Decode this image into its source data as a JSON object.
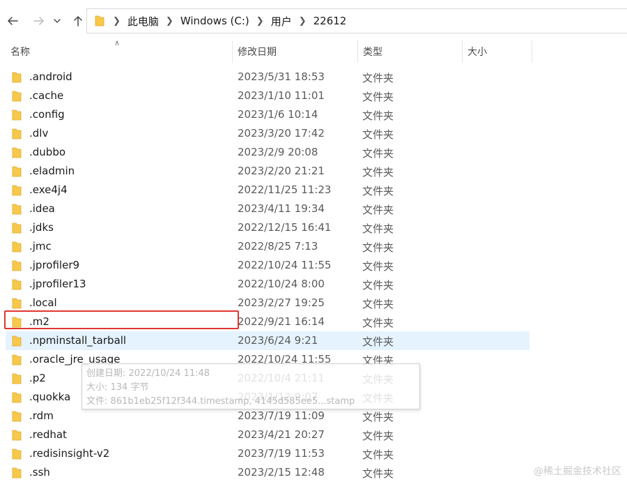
{
  "colors": {
    "accent": "#0078d4",
    "folder": "#f8c84a",
    "hover_row": "#e5f3ff",
    "highlight_box": "#e0362f"
  },
  "nav": {
    "back_icon": "arrow-left-icon",
    "forward_icon": "arrow-right-icon",
    "recent_icon": "chevron-down-icon",
    "up_icon": "arrow-up-icon"
  },
  "address": {
    "crumbs": [
      "此电脑",
      "Windows (C:)",
      "用户",
      "22612"
    ]
  },
  "columns": {
    "name": "名称",
    "modified": "修改日期",
    "type": "类型",
    "size": "大小"
  },
  "rows": [
    {
      "name": ".android",
      "modified": "2023/5/31 18:53",
      "type": "文件夹"
    },
    {
      "name": ".cache",
      "modified": "2023/1/10 11:01",
      "type": "文件夹"
    },
    {
      "name": ".config",
      "modified": "2023/1/6 10:14",
      "type": "文件夹"
    },
    {
      "name": ".dlv",
      "modified": "2023/3/20 17:42",
      "type": "文件夹"
    },
    {
      "name": ".dubbo",
      "modified": "2023/2/9 20:08",
      "type": "文件夹"
    },
    {
      "name": ".eladmin",
      "modified": "2023/2/20 21:21",
      "type": "文件夹"
    },
    {
      "name": ".exe4j4",
      "modified": "2022/11/25 11:23",
      "type": "文件夹"
    },
    {
      "name": ".idea",
      "modified": "2023/4/11 19:34",
      "type": "文件夹"
    },
    {
      "name": ".jdks",
      "modified": "2022/12/15 16:41",
      "type": "文件夹"
    },
    {
      "name": ".jmc",
      "modified": "2022/8/25 7:13",
      "type": "文件夹"
    },
    {
      "name": ".jprofiler9",
      "modified": "2022/10/24 11:55",
      "type": "文件夹"
    },
    {
      "name": ".jprofiler13",
      "modified": "2022/10/24 8:00",
      "type": "文件夹"
    },
    {
      "name": ".local",
      "modified": "2023/2/27 19:25",
      "type": "文件夹"
    },
    {
      "name": ".m2",
      "modified": "2022/9/21 16:14",
      "type": "文件夹"
    },
    {
      "name": ".npminstall_tarball",
      "modified": "2023/6/24 9:21",
      "type": "文件夹"
    },
    {
      "name": ".oracle_jre_usage",
      "modified": "2022/10/24 11:55",
      "type": "文件夹"
    },
    {
      "name": ".p2",
      "modified": "2022/10/4 21:11",
      "type": "文件夹"
    },
    {
      "name": ".quokka",
      "modified": "2023/1/12 9:07",
      "type": "文件夹"
    },
    {
      "name": ".rdm",
      "modified": "2023/7/19 11:09",
      "type": "文件夹"
    },
    {
      "name": ".redhat",
      "modified": "2023/4/21 20:27",
      "type": "文件夹"
    },
    {
      "name": ".redisinsight-v2",
      "modified": "2023/7/19 11:53",
      "type": "文件夹"
    },
    {
      "name": ".ssh",
      "modified": "2023/2/15 12:48",
      "type": "文件夹"
    }
  ],
  "tooltip": {
    "created": "创建日期: 2022/10/24 11:48",
    "size": "大小: 134 字节",
    "files": "文件: 861b1eb25f12f344.timestamp, 4145d585ee5...stamp"
  },
  "watermark": "@稀土掘金技术社区"
}
